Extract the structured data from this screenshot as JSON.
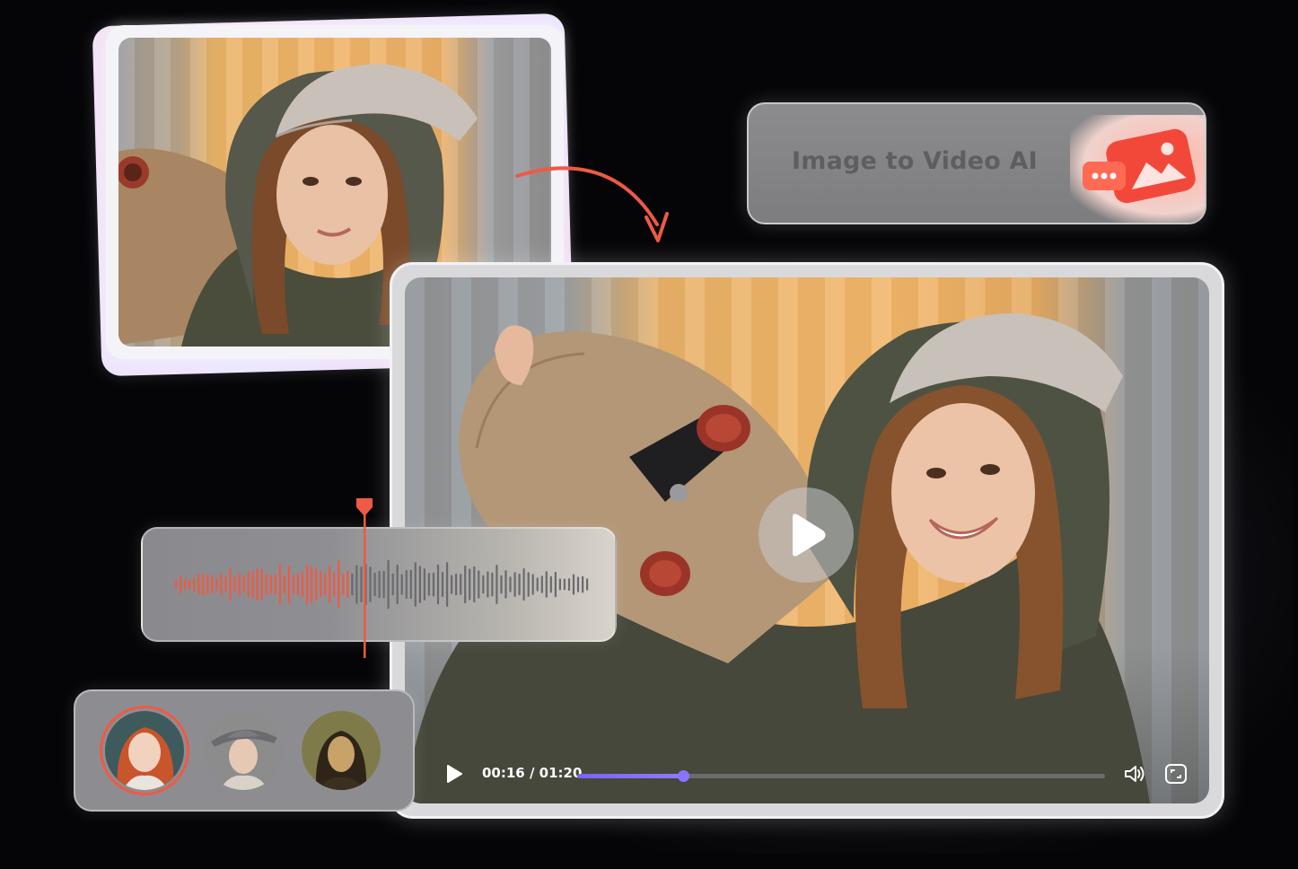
{
  "title_card": {
    "title": "Image to Video AI",
    "icon": "image-to-video-app-icon"
  },
  "player": {
    "time_display": "00:16 / 01:20",
    "progress": 0.2,
    "play_icon": "play-icon",
    "volume_icon": "volume-icon",
    "fullscreen_icon": "fullscreen-icon"
  },
  "waveform": {
    "playhead_position": 0.42,
    "played_color": "#ee5a45",
    "unplayed_color": "#6a6a6e"
  },
  "avatars": {
    "items": [
      "avatar-red-hair-woman",
      "avatar-woman-with-hat",
      "avatar-mona-lisa"
    ],
    "selected_index": 0,
    "selected_color": "#ee5a45"
  },
  "colors": {
    "accent": "#ee5a45",
    "progress": "#7b62ff"
  }
}
